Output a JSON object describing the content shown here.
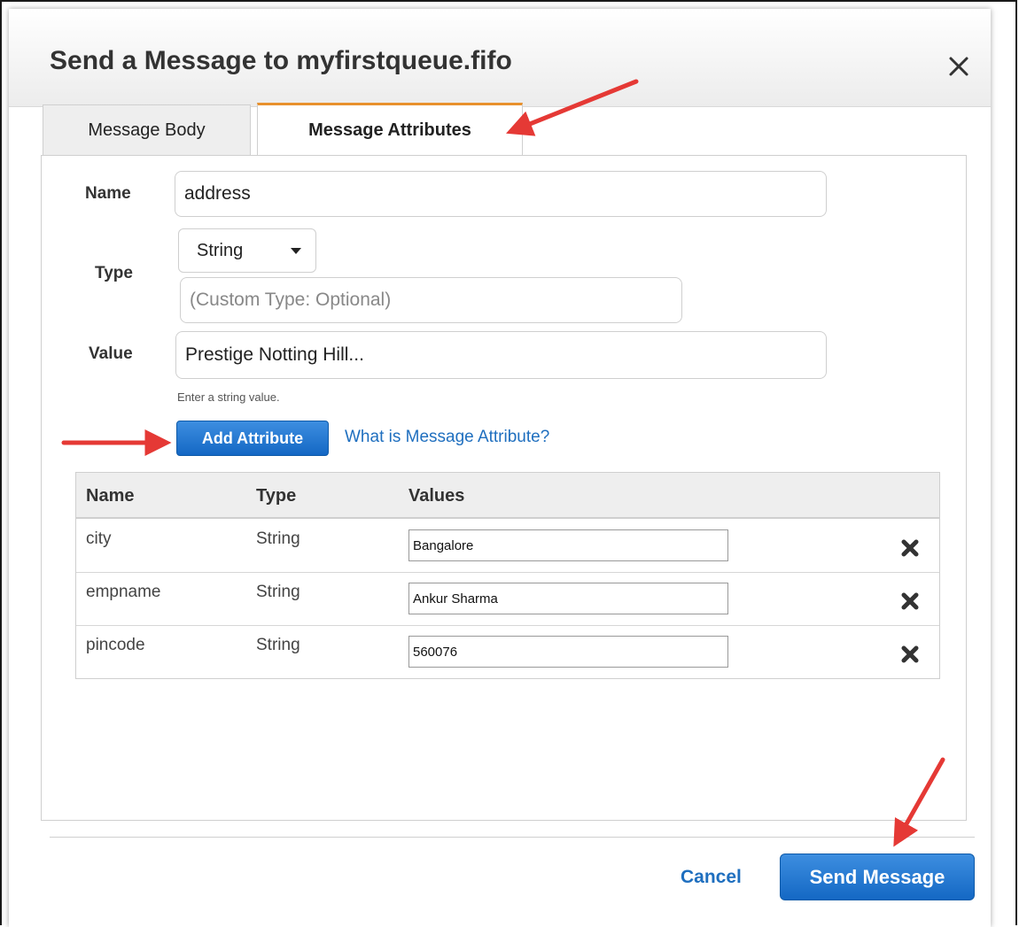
{
  "dialog": {
    "title": "Send a Message to myfirstqueue.fifo"
  },
  "tabs": [
    {
      "label": "Message Body",
      "active": false
    },
    {
      "label": "Message Attributes",
      "active": true
    }
  ],
  "form": {
    "name_label": "Name",
    "name_value": "address",
    "type_label": "Type",
    "type_selected": "String",
    "custom_type_placeholder": "(Custom Type: Optional)",
    "value_label": "Value",
    "value_value": "Prestige Notting Hill...",
    "value_hint": "Enter a string value.",
    "add_attribute_label": "Add Attribute",
    "help_link": "What is Message Attribute?"
  },
  "table": {
    "headers": [
      "Name",
      "Type",
      "Values"
    ],
    "rows": [
      {
        "name": "city",
        "type": "String",
        "value": "Bangalore"
      },
      {
        "name": "empname",
        "type": "String",
        "value": "Ankur Sharma"
      },
      {
        "name": "pincode",
        "type": "String",
        "value": "560076"
      }
    ]
  },
  "footer": {
    "cancel_label": "Cancel",
    "send_label": "Send Message"
  },
  "colors": {
    "primary_button": "#1468c4",
    "link": "#1f6fbf",
    "active_tab_accent": "#e8912d",
    "annotation_arrow": "#e53935"
  },
  "icons": {
    "close": "close-icon",
    "remove": "remove-x-icon",
    "dropdown": "chevron-down-icon",
    "annotation": "red-arrow-annotation"
  }
}
